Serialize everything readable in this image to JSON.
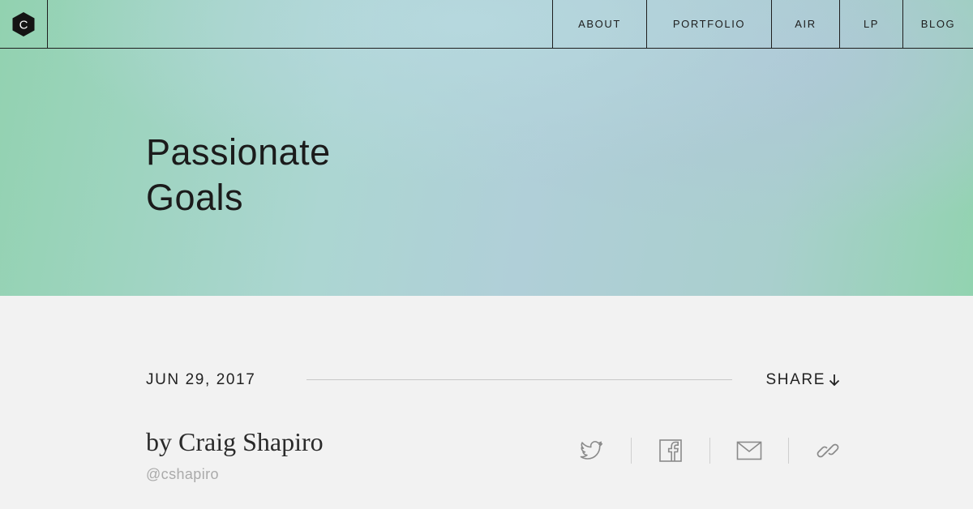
{
  "header": {
    "logo_letter": "C",
    "nav": [
      {
        "label": "ABOUT"
      },
      {
        "label": "PORTFOLIO"
      },
      {
        "label": "AIR"
      },
      {
        "label": "LP"
      },
      {
        "label": "BLOG"
      }
    ]
  },
  "hero": {
    "title_line1": "Passionate",
    "title_line2": "Goals"
  },
  "post": {
    "date": "JUN 29, 2017",
    "share_label": "SHARE",
    "byline": "by Craig Shapiro",
    "handle": "@cshapiro"
  },
  "share_icons": [
    "twitter-icon",
    "facebook-icon",
    "mail-icon",
    "link-icon"
  ],
  "colors": {
    "hero_green": "#92d2b0",
    "hero_blue": "#b6d8de",
    "page_bg": "#f2f2f2",
    "ink": "#1a1a1a",
    "muted": "#aaaaaa",
    "icon_gray": "#8a8a8a"
  }
}
